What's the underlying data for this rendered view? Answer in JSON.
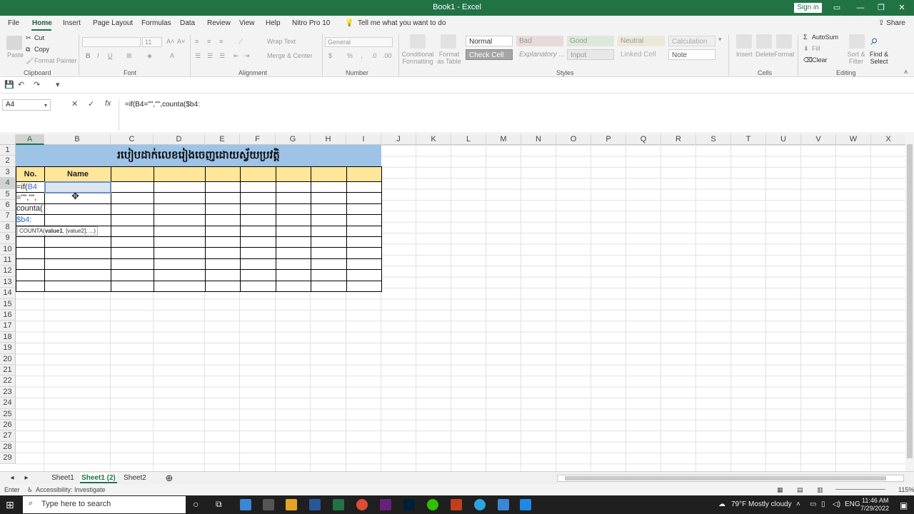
{
  "window": {
    "title": "Book1 - Excel",
    "sign_in": "Sign in"
  },
  "ribbon_tabs": [
    "File",
    "Home",
    "Insert",
    "Page Layout",
    "Formulas",
    "Data",
    "Review",
    "View",
    "Help",
    "Nitro Pro 10"
  ],
  "tell_me": "Tell me what you want to do",
  "share": "Share",
  "clipboard": {
    "paste": "Paste",
    "cut": "Cut",
    "copy": "Copy",
    "format_painter": "Format Painter",
    "label": "Clipboard"
  },
  "font_group": {
    "label": "Font",
    "size": "11"
  },
  "alignment_group": {
    "label": "Alignment",
    "wrap_text": "Wrap Text",
    "merge_center": "Merge & Center"
  },
  "number_group": {
    "label": "Number",
    "format": "General"
  },
  "styles_group": {
    "label": "Styles",
    "conditional_formatting": "Conditional Formatting",
    "format_as_table": "Format as Table",
    "cell_styles": [
      "Normal",
      "Bad",
      "Good",
      "Neutral",
      "Calculation",
      "Check Cell",
      "Explanatory ...",
      "Input",
      "Linked Cell",
      "Note"
    ]
  },
  "cells_group": {
    "label": "Cells",
    "insert": "Insert",
    "delete": "Delete",
    "format": "Format"
  },
  "editing_group": {
    "label": "Editing",
    "autosum": "AutoSum",
    "fill": "Fill",
    "clear": "Clear",
    "sort_filter": "Sort & Filter",
    "find_select": "Find & Select"
  },
  "formula_bar": {
    "name_box": "A4",
    "formula": "=if(B4=\"\",\"\",counta($b4:"
  },
  "columns": [
    "A",
    "B",
    "C",
    "D",
    "E",
    "F",
    "G",
    "H",
    "I",
    "J",
    "K",
    "L",
    "M",
    "N",
    "O",
    "P",
    "Q",
    "R",
    "S",
    "T",
    "U",
    "V",
    "W",
    "X"
  ],
  "rows": [
    "1",
    "2",
    "3",
    "4",
    "5",
    "6",
    "7",
    "8",
    "9",
    "10",
    "11",
    "12",
    "13",
    "14",
    "15",
    "16",
    "17",
    "18",
    "19",
    "20",
    "21",
    "22",
    "23",
    "24",
    "25",
    "26",
    "27",
    "28",
    "29"
  ],
  "sheet": {
    "title_banner": "របៀបដាក់លេខរៀងចេញដោយស្វ័យប្រវត្តិ",
    "header_no": "No.",
    "header_name": "Name",
    "formula_fragments": [
      "=if(",
      "B4",
      "=\"\",\"\",",
      "counta(",
      "$b4:"
    ],
    "tooltip_fn": "COUNTA(",
    "tooltip_arg1": "value1",
    "tooltip_rest": ", [value2], ...)"
  },
  "sheet_tabs": [
    "Sheet1",
    "Sheet1 (2)",
    "Sheet2"
  ],
  "active_sheet": "Sheet1 (2)",
  "status": {
    "mode": "Enter",
    "accessibility": "Accessibility: Investigate",
    "zoom": "115%"
  },
  "taskbar": {
    "search_placeholder": "Type here to search",
    "weather": "79°F  Mostly cloudy",
    "lang": "ENG",
    "time": "11:46 AM",
    "date": "7/29/2022"
  },
  "colors": {
    "excel_green": "#217346",
    "banner_blue": "#9dc3e6",
    "header_yellow": "#ffe699",
    "formula_blue": "#2f6fd1"
  }
}
